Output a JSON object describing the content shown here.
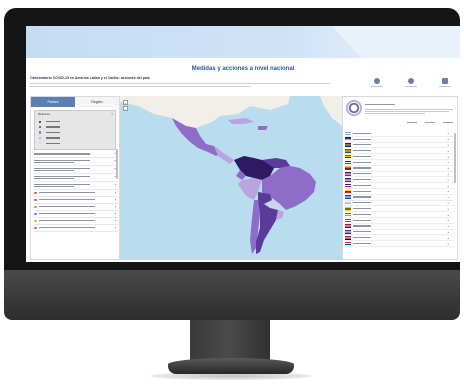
{
  "page": {
    "title": "Medidas y acciones a nivel nacional",
    "subtitle": "Observatorio COVID-19 en América Latina y el Caribe: acciones del país"
  },
  "left_panel": {
    "tabs": [
      {
        "label": "Países",
        "active": true
      },
      {
        "label": "Región",
        "active": false
      }
    ],
    "legend": {
      "title": "Mediciones",
      "close": "×",
      "colors": [
        "#2e1a63",
        "#5b3a99",
        "#8e6cc8",
        "#b9a4de",
        "#d9cdef"
      ]
    },
    "filters": [
      {
        "lines": 1,
        "color": "",
        "plus": "+"
      },
      {
        "lines": 2,
        "color": "",
        "plus": "+"
      },
      {
        "lines": 2,
        "color": "",
        "plus": "+"
      },
      {
        "lines": 2,
        "color": "",
        "plus": "+"
      },
      {
        "lines": 2,
        "color": "",
        "plus": "+"
      },
      {
        "lines": 1,
        "color": "#e05a3a",
        "plus": "+"
      },
      {
        "lines": 1,
        "color": "#e94e77",
        "plus": "+"
      },
      {
        "lines": 1,
        "color": "#f08a3a",
        "plus": "+"
      },
      {
        "lines": 1,
        "color": "#3a8fd1",
        "plus": "+"
      },
      {
        "lines": 1,
        "color": "#e6b23a",
        "plus": "+"
      },
      {
        "lines": 1,
        "color": "#e85b3a",
        "plus": "+"
      }
    ]
  },
  "map": {
    "zoom_in": "+",
    "zoom_out": "−",
    "ocean_color": "#b9dcef",
    "land_color": "#f1efe8",
    "country_shades": [
      "#2e1a63",
      "#5b3a99",
      "#8e6cc8",
      "#b9a4de",
      "#d9cdef"
    ]
  },
  "right_panel": {
    "countries": [
      {
        "flag": [
          "#74acdf",
          "#ffffff",
          "#74acdf"
        ],
        "plus": "+"
      },
      {
        "flag": [
          "#00247d",
          "#cf142b",
          "#ffffff"
        ],
        "plus": "+"
      },
      {
        "flag": [
          "#00267f",
          "#ffc726",
          "#00267f"
        ],
        "plus": "+"
      },
      {
        "flag": [
          "#d52b1e",
          "#f9e300",
          "#007934"
        ],
        "plus": "+"
      },
      {
        "flag": [
          "#009c3b",
          "#ffdf00",
          "#002776"
        ],
        "plus": "+"
      },
      {
        "flag": [
          "#0039a6",
          "#ffffff",
          "#d52b1e"
        ],
        "plus": "+"
      },
      {
        "flag": [
          "#fcd116",
          "#003893",
          "#ce1126"
        ],
        "plus": "+"
      },
      {
        "flag": [
          "#002b7f",
          "#ffffff",
          "#ce1126"
        ],
        "plus": "+"
      },
      {
        "flag": [
          "#002a8f",
          "#ffffff",
          "#cf142b"
        ],
        "plus": "+"
      },
      {
        "flag": [
          "#002d62",
          "#ffffff",
          "#ce1126"
        ],
        "plus": "+"
      },
      {
        "flag": [
          "#ffd100",
          "#034ea2",
          "#ed1c24"
        ],
        "plus": "+"
      },
      {
        "flag": [
          "#0f47af",
          "#ffffff",
          "#0f47af"
        ],
        "plus": "+"
      },
      {
        "flag": [
          "#ffffff",
          "#4997d0",
          "#ffffff"
        ],
        "plus": "+"
      },
      {
        "flag": [
          "#ffd100",
          "#000000",
          "#ffd100"
        ],
        "plus": "+"
      },
      {
        "flag": [
          "#009e60",
          "#ffffff",
          "#ff8c00"
        ],
        "plus": "+"
      },
      {
        "flag": [
          "#0073cf",
          "#ffffff",
          "#0073cf"
        ],
        "plus": "+"
      },
      {
        "flag": [
          "#bf0a30",
          "#ffffff",
          "#002868"
        ],
        "plus": "+"
      },
      {
        "flag": [
          "#d21034",
          "#ffffff",
          "#0035ad"
        ],
        "plus": "+"
      },
      {
        "flag": [
          "#ce1126",
          "#ffffff",
          "#000000"
        ],
        "plus": "+"
      },
      {
        "flag": [
          "#d52b1e",
          "#ffffff",
          "#0038a8"
        ],
        "plus": "+"
      }
    ]
  },
  "colors": {
    "accent": "#5b7eb3",
    "title": "#2d5a8a",
    "banner": "#c5dcf3"
  }
}
